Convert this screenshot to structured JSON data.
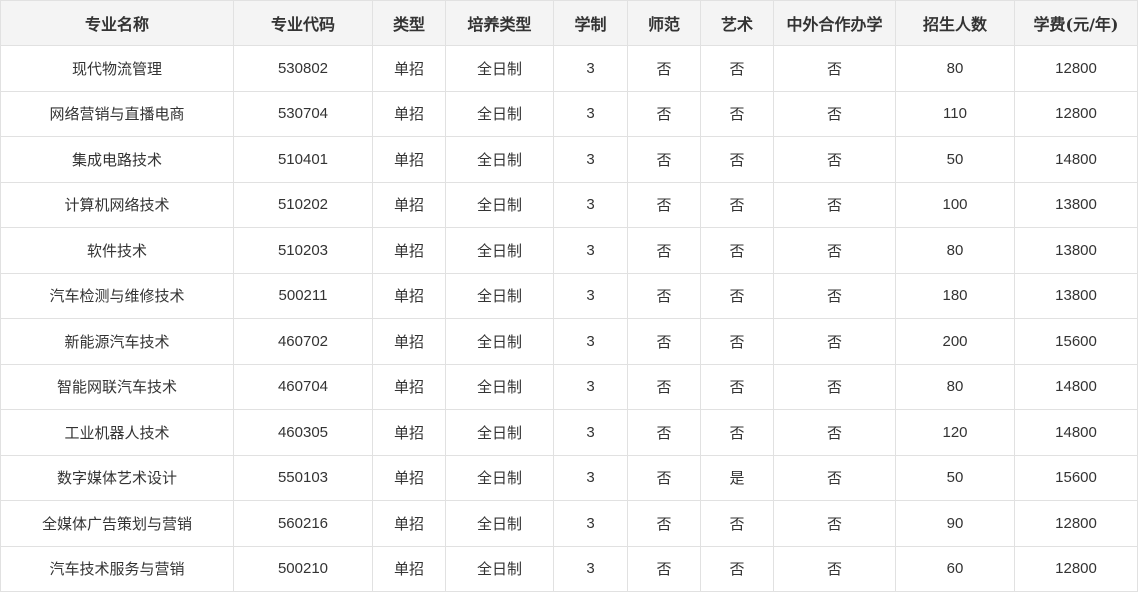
{
  "headers": [
    "专业名称",
    "专业代码",
    "类型",
    "培养类型",
    "学制",
    "师范",
    "艺术",
    "中外合作办学",
    "招生人数",
    "学费(元/年)"
  ],
  "rows": [
    [
      "现代物流管理",
      "530802",
      "单招",
      "全日制",
      "3",
      "否",
      "否",
      "否",
      "80",
      "12800"
    ],
    [
      "网络营销与直播电商",
      "530704",
      "单招",
      "全日制",
      "3",
      "否",
      "否",
      "否",
      "110",
      "12800"
    ],
    [
      "集成电路技术",
      "510401",
      "单招",
      "全日制",
      "3",
      "否",
      "否",
      "否",
      "50",
      "14800"
    ],
    [
      "计算机网络技术",
      "510202",
      "单招",
      "全日制",
      "3",
      "否",
      "否",
      "否",
      "100",
      "13800"
    ],
    [
      "软件技术",
      "510203",
      "单招",
      "全日制",
      "3",
      "否",
      "否",
      "否",
      "80",
      "13800"
    ],
    [
      "汽车检测与维修技术",
      "500211",
      "单招",
      "全日制",
      "3",
      "否",
      "否",
      "否",
      "180",
      "13800"
    ],
    [
      "新能源汽车技术",
      "460702",
      "单招",
      "全日制",
      "3",
      "否",
      "否",
      "否",
      "200",
      "15600"
    ],
    [
      "智能网联汽车技术",
      "460704",
      "单招",
      "全日制",
      "3",
      "否",
      "否",
      "否",
      "80",
      "14800"
    ],
    [
      "工业机器人技术",
      "460305",
      "单招",
      "全日制",
      "3",
      "否",
      "否",
      "否",
      "120",
      "14800"
    ],
    [
      "数字媒体艺术设计",
      "550103",
      "单招",
      "全日制",
      "3",
      "否",
      "是",
      "否",
      "50",
      "15600"
    ],
    [
      "全媒体广告策划与营销",
      "560216",
      "单招",
      "全日制",
      "3",
      "否",
      "否",
      "否",
      "90",
      "12800"
    ],
    [
      "汽车技术服务与营销",
      "500210",
      "单招",
      "全日制",
      "3",
      "否",
      "否",
      "否",
      "60",
      "12800"
    ]
  ]
}
